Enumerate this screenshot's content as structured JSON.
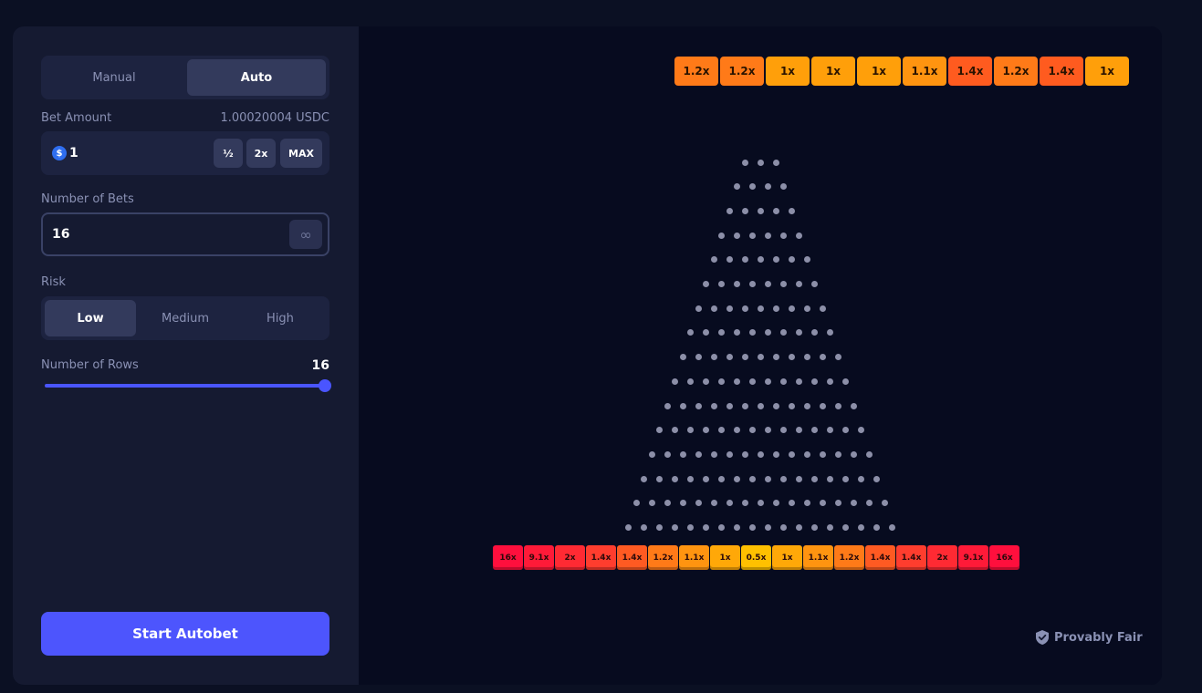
{
  "sidebar": {
    "mode_tabs": {
      "manual": "Manual",
      "auto": "Auto"
    },
    "bet_amount": {
      "label": "Bet Amount",
      "balance": "1.00020004 USDC",
      "currency_icon": "usdc-coin-icon",
      "value": "1",
      "half_label": "½",
      "double_label": "2x",
      "max_label": "MAX"
    },
    "number_of_bets": {
      "label": "Number of Bets",
      "value": "16",
      "infinity_label": "∞"
    },
    "risk": {
      "label": "Risk",
      "options": [
        "Low",
        "Medium",
        "High"
      ],
      "selected": "Low"
    },
    "rows": {
      "label": "Number of Rows",
      "value": "16",
      "fill": 1.0
    },
    "start_button": "Start Autobet"
  },
  "board": {
    "history": [
      {
        "label": "1.2x",
        "color": "#ff7a18"
      },
      {
        "label": "1.2x",
        "color": "#ff7a18"
      },
      {
        "label": "1x",
        "color": "#ff9f0a"
      },
      {
        "label": "1x",
        "color": "#ff9f0a"
      },
      {
        "label": "1x",
        "color": "#ff9f0a"
      },
      {
        "label": "1.1x",
        "color": "#ff9410"
      },
      {
        "label": "1.4x",
        "color": "#ff5b1f"
      },
      {
        "label": "1.2x",
        "color": "#ff7a18"
      },
      {
        "label": "1.4x",
        "color": "#ff5b1f"
      },
      {
        "label": "1x",
        "color": "#ff9f0a"
      }
    ],
    "multipliers": [
      {
        "label": "16x",
        "color": "#ff0f3d"
      },
      {
        "label": "9.1x",
        "color": "#ff1a38"
      },
      {
        "label": "2x",
        "color": "#ff2a33"
      },
      {
        "label": "1.4x",
        "color": "#ff3d2e"
      },
      {
        "label": "1.4x",
        "color": "#ff5a22"
      },
      {
        "label": "1.2x",
        "color": "#ff7a18"
      },
      {
        "label": "1.1x",
        "color": "#ff9410"
      },
      {
        "label": "1x",
        "color": "#ffa808"
      },
      {
        "label": "0.5x",
        "color": "#ffc000"
      },
      {
        "label": "1x",
        "color": "#ffa808"
      },
      {
        "label": "1.1x",
        "color": "#ff9410"
      },
      {
        "label": "1.2x",
        "color": "#ff7a18"
      },
      {
        "label": "1.4x",
        "color": "#ff5a22"
      },
      {
        "label": "1.4x",
        "color": "#ff3d2e"
      },
      {
        "label": "2x",
        "color": "#ff2a33"
      },
      {
        "label": "9.1x",
        "color": "#ff1a38"
      },
      {
        "label": "16x",
        "color": "#ff0f3d"
      }
    ],
    "peg_rows": 16,
    "provably_fair": "Provably Fair"
  },
  "colors": {
    "accent": "#4d55fd",
    "panel": "#151a31",
    "board_bg": "#070b1f"
  }
}
